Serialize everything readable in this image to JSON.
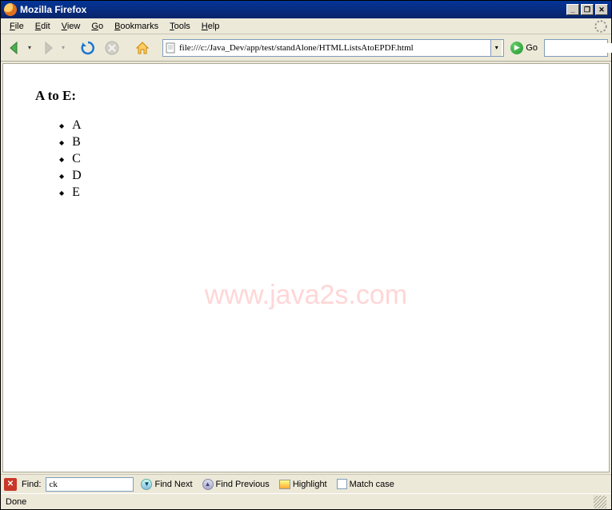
{
  "window": {
    "title": "Mozilla Firefox"
  },
  "menu": {
    "file": "File",
    "edit": "Edit",
    "view": "View",
    "go": "Go",
    "bookmarks": "Bookmarks",
    "tools": "Tools",
    "help": "Help"
  },
  "toolbar": {
    "url": "file:///c:/Java_Dev/app/test/standAlone/HTMLListsAtoEPDF.html",
    "go_label": "Go"
  },
  "page": {
    "heading": "A to E:",
    "items": [
      "A",
      "B",
      "C",
      "D",
      "E"
    ],
    "watermark": "www.java2s.com"
  },
  "find": {
    "label": "Find:",
    "value": "ck",
    "next": "Find Next",
    "previous": "Find Previous",
    "highlight": "Highlight",
    "match_case": "Match case"
  },
  "status": {
    "text": "Done"
  }
}
